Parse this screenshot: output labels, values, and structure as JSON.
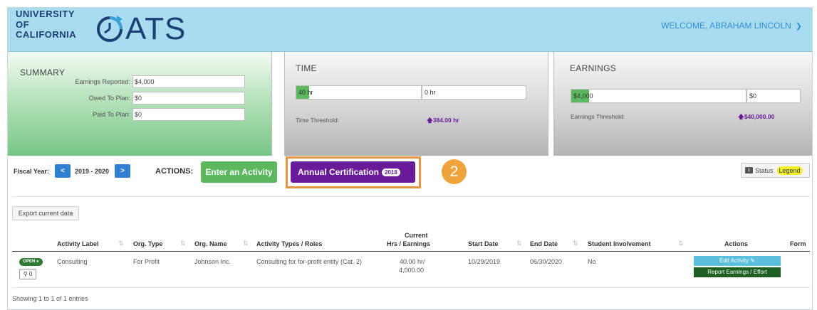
{
  "header": {
    "uc_logo_lines": [
      "UNIVERSITY",
      "OF",
      "CALIFORNIA"
    ],
    "app_name": "ATS",
    "welcome": "WELCOME, ABRAHAM LINCOLN"
  },
  "summary": {
    "title": "SUMMARY",
    "rows": [
      {
        "label": "Earnings Reported:",
        "value": "$4,000"
      },
      {
        "label": "Owed To Plan:",
        "value": "$0"
      },
      {
        "label": "Paid To Plan:",
        "value": "$0"
      }
    ]
  },
  "time": {
    "title": "TIME",
    "used": "40 hr",
    "remaining": "0 hr",
    "used_fraction": 0.104,
    "threshold_label": "Time Threshold:",
    "threshold_value": "384.00 hr"
  },
  "earnings": {
    "title": "EARNINGS",
    "used": "$4,000",
    "remaining": "$0",
    "used_fraction": 0.1,
    "threshold_label": "Earnings Threshold:",
    "threshold_value": "$40,000.00"
  },
  "actionbar": {
    "fiscal_year_label": "Fiscal Year:",
    "fiscal_year": "2019 - 2020",
    "prev": "<",
    "next": ">",
    "actions_label": "ACTIONS:",
    "enter_activity": "Enter an Activity",
    "annual_cert": "Annual Certification",
    "annual_cert_badge": "2018",
    "step_number": "2",
    "status": "Status",
    "legend": "Legend"
  },
  "export_label": "Export current data",
  "table": {
    "headers": {
      "activity_label": "Activity Label",
      "org_type": "Org. Type",
      "org_name": "Org. Name",
      "activity_types": "Activity Types / Roles",
      "current_line1": "Current",
      "current_line2": "Hrs / Earnings",
      "start_date": "Start Date",
      "end_date": "End Date",
      "student_involvement": "Student Involvement",
      "actions": "Actions",
      "form": "Form"
    },
    "rows": [
      {
        "status": "OPEN",
        "tag_count": "0",
        "activity_label": "Consulting",
        "org_type": "For Profit",
        "org_name": "Johnson Inc.",
        "activity_type": "Consulting for for-profit entity (Cat. 2)",
        "hrs": "40.00 hr/",
        "earnings": "4,000.00",
        "start_date": "10/29/2019",
        "end_date": "06/30/2020",
        "student_involvement": "No",
        "edit_label": "Edit Activity",
        "report_label": "Report Earnings / Effort"
      }
    ]
  },
  "footer": {
    "showing": "Showing 1 to 1 of 1 entries"
  },
  "colors": {
    "header_bg": "#a9dcef",
    "brand_navy": "#1c3f76",
    "green": "#5cb85c",
    "purple": "#6a1b9a",
    "orange_highlight": "#e59442",
    "blue_nav": "#2f7fd3"
  }
}
